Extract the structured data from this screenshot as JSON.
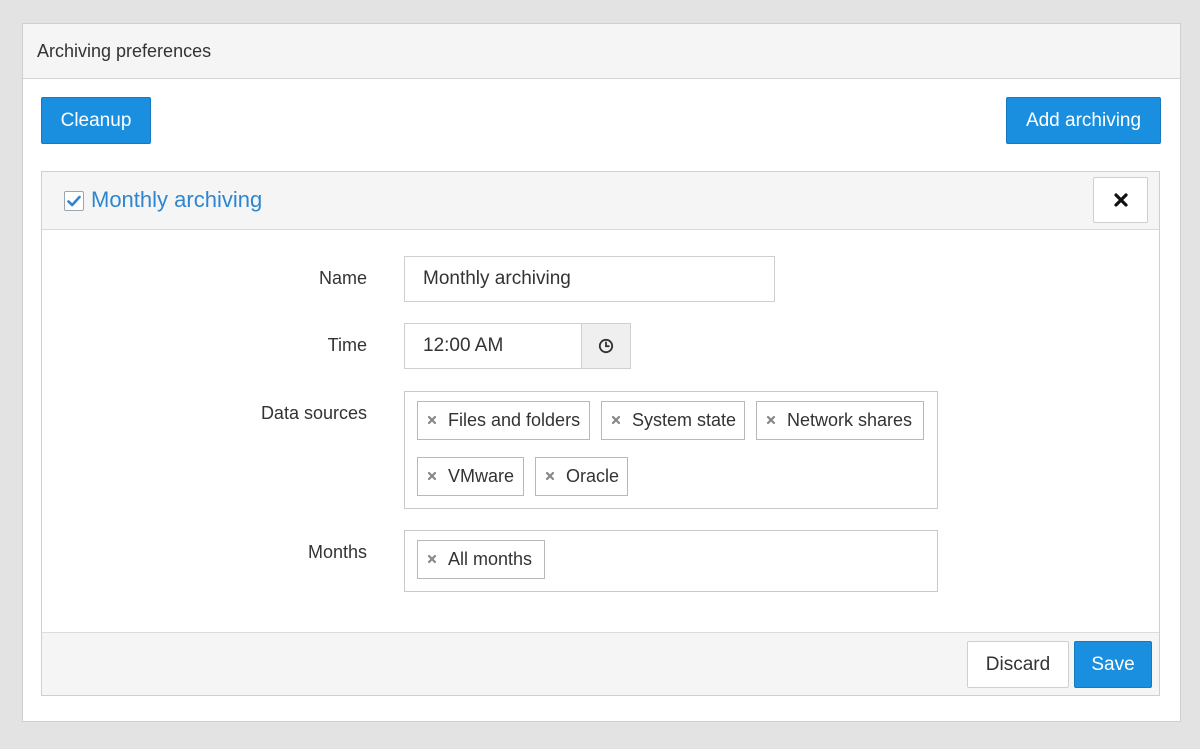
{
  "panel": {
    "title": "Archiving preferences"
  },
  "toolbar": {
    "cleanup_label": "Cleanup",
    "add_label": "Add archiving"
  },
  "card": {
    "enabled": true,
    "title": "Monthly archiving",
    "close_icon": "close-icon"
  },
  "form": {
    "name_label": "Name",
    "name_value": "Monthly archiving",
    "time_label": "Time",
    "time_value": "12:00 AM",
    "time_icon": "clock-icon",
    "sources_label": "Data sources",
    "sources": [
      "Files and folders",
      "System state",
      "Network shares",
      "VMware",
      "Oracle"
    ],
    "months_label": "Months",
    "months": [
      "All months"
    ]
  },
  "footer": {
    "discard_label": "Discard",
    "save_label": "Save"
  },
  "colors": {
    "accent": "#1a8fe0",
    "title_link": "#2f86d0",
    "background": "#e3e3e3",
    "header_bg": "#f5f5f5"
  }
}
